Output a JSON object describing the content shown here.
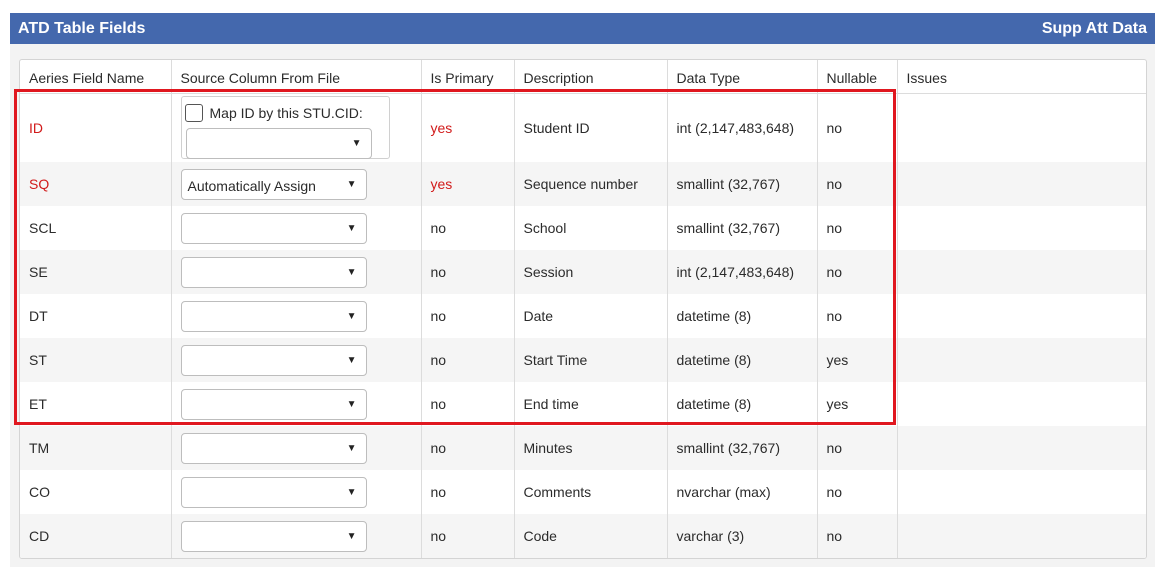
{
  "header": {
    "title": "ATD Table Fields",
    "right_title": "Supp Att Data"
  },
  "columns": [
    "Aeries Field Name",
    "Source Column From File",
    "Is Primary",
    "Description",
    "Data Type",
    "Nullable",
    "Issues"
  ],
  "map_option": {
    "label": "Map ID by this STU.CID:",
    "checked": false
  },
  "rows": [
    {
      "field": "ID",
      "source": "",
      "primary": "yes",
      "description": "Student ID",
      "type": "int (2,147,483,648)",
      "nullable": "no",
      "issues": ""
    },
    {
      "field": "SQ",
      "source": "Automatically Assign",
      "primary": "yes",
      "description": "Sequence number",
      "type": "smallint (32,767)",
      "nullable": "no",
      "issues": ""
    },
    {
      "field": "SCL",
      "source": "",
      "primary": "no",
      "description": "School",
      "type": "smallint (32,767)",
      "nullable": "no",
      "issues": ""
    },
    {
      "field": "SE",
      "source": "",
      "primary": "no",
      "description": "Session",
      "type": "int (2,147,483,648)",
      "nullable": "no",
      "issues": ""
    },
    {
      "field": "DT",
      "source": "",
      "primary": "no",
      "description": "Date",
      "type": "datetime (8)",
      "nullable": "no",
      "issues": ""
    },
    {
      "field": "ST",
      "source": "",
      "primary": "no",
      "description": "Start Time",
      "type": "datetime (8)",
      "nullable": "yes",
      "issues": ""
    },
    {
      "field": "ET",
      "source": "",
      "primary": "no",
      "description": "End time",
      "type": "datetime (8)",
      "nullable": "yes",
      "issues": ""
    },
    {
      "field": "TM",
      "source": "",
      "primary": "no",
      "description": "Minutes",
      "type": "smallint (32,767)",
      "nullable": "no",
      "issues": ""
    },
    {
      "field": "CO",
      "source": "",
      "primary": "no",
      "description": "Comments",
      "type": "nvarchar (max)",
      "nullable": "no",
      "issues": ""
    },
    {
      "field": "CD",
      "source": "",
      "primary": "no",
      "description": "Code",
      "type": "varchar (3)",
      "nullable": "no",
      "issues": ""
    }
  ],
  "dropdown_arrow": "▼",
  "colors": {
    "header_bg": "#4468ad",
    "required_text": "#d11a1a",
    "highlight_border": "#e0171f",
    "alt_row_bg": "#f5f5f5"
  }
}
